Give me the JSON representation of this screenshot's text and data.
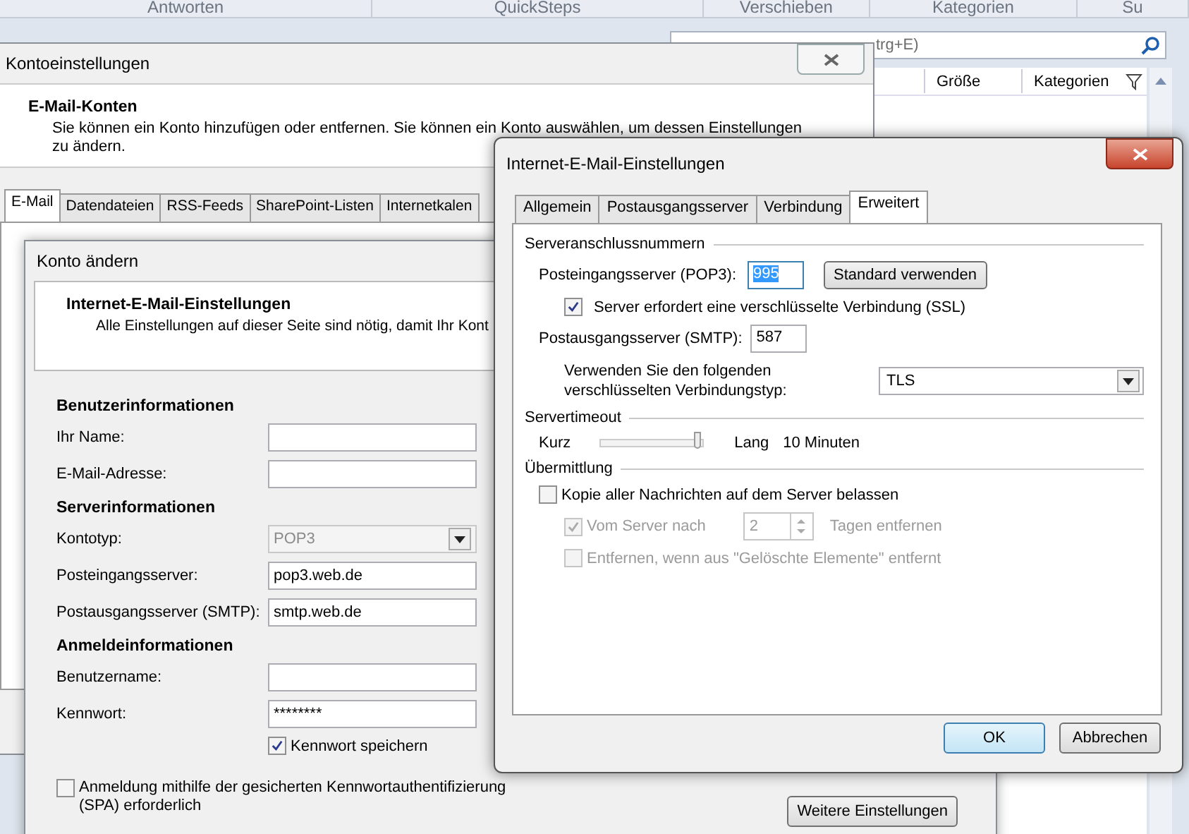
{
  "ribbon": {
    "groups": [
      "Antworten",
      "QuickSteps",
      "Verschieben",
      "Kategorien",
      "Su"
    ]
  },
  "mail_list": {
    "search": {
      "placeholder": "trg+E)"
    },
    "columns": [
      "Größe",
      "Kategorien"
    ]
  },
  "account_settings": {
    "title": "Kontoeinstellungen",
    "heading": "E-Mail-Konten",
    "description": "Sie können ein Konto hinzufügen oder entfernen. Sie können ein Konto auswählen, um dessen Einstellungen zu ändern.",
    "tabs": [
      {
        "label": "E-Mail",
        "selected": true
      },
      {
        "label": "Datendateien",
        "selected": false
      },
      {
        "label": "RSS-Feeds",
        "selected": false
      },
      {
        "label": "SharePoint-Listen",
        "selected": false
      },
      {
        "label": "Internetkalen",
        "selected": false
      }
    ]
  },
  "change_account": {
    "title": "Konto ändern",
    "heading": "Internet-E-Mail-Einstellungen",
    "description": "Alle Einstellungen auf dieser Seite sind nötig, damit Ihr Kont",
    "sections": [
      {
        "title": "Benutzerinformationen",
        "fields": [
          {
            "label": "Ihr Name:",
            "kind": "text",
            "disabled": false
          },
          {
            "label": "E-Mail-Adresse:",
            "kind": "text",
            "disabled": false
          }
        ]
      },
      {
        "title": "Serverinformationen",
        "fields": [
          {
            "label": "Kontotyp:",
            "kind": "select",
            "value": "POP3",
            "disabled": true
          },
          {
            "label": "Posteingangsserver:",
            "kind": "text",
            "value": "pop3.web.de",
            "disabled": false
          },
          {
            "label": "Postausgangsserver (SMTP):",
            "kind": "text",
            "value": "smtp.web.de",
            "disabled": false
          }
        ]
      },
      {
        "title": "Anmeldeinformationen",
        "fields": [
          {
            "label": "Benutzername:",
            "kind": "text",
            "disabled": false
          },
          {
            "label": "Kennwort:",
            "kind": "text",
            "value": "********",
            "disabled": false
          }
        ]
      }
    ],
    "remember_password": {
      "label": "Kennwort speichern",
      "checked": true
    },
    "spa": {
      "label": "Anmeldung mithilfe der gesicherten Kennwortauthentifizierung (SPA) erforderlich",
      "checked": false
    },
    "more_button": "Weitere Einstellungen"
  },
  "internet_settings": {
    "title": "Internet-E-Mail-Einstellungen",
    "tabs": [
      {
        "label": "Allgemein",
        "selected": false
      },
      {
        "label": "Postausgangsserver",
        "selected": false
      },
      {
        "label": "Verbindung",
        "selected": false
      },
      {
        "label": "Erweitert",
        "selected": true
      }
    ],
    "ports": {
      "title": "Serveranschlussnummern",
      "incoming_label": "Posteingangsserver (POP3):",
      "incoming_value": "995",
      "incoming_highlighted": true,
      "default_button": "Standard verwenden",
      "ssl": {
        "label": "Server erfordert eine verschlüsselte Verbindung (SSL)",
        "checked": true
      },
      "outgoing_label": "Postausgangsserver (SMTP):",
      "outgoing_value": "587",
      "encryption_label": "Verwenden Sie den folgenden verschlüsselten Verbindungstyp:",
      "encryption_value": "TLS"
    },
    "timeout": {
      "title": "Servertimeout",
      "min_label": "Kurz",
      "max_label": "Lang",
      "level": 0.97,
      "reading": "10 Minuten"
    },
    "delivery": {
      "title": "Übermittlung",
      "keep_copy": {
        "label": "Kopie aller Nachrichten auf dem Server belassen",
        "checked": false,
        "disabled": false
      },
      "remove_after": {
        "label": "Vom Server nach",
        "checked": true,
        "disabled": true,
        "days": "2",
        "suffix": "Tagen entfernen"
      },
      "remove_deleted": {
        "label": "Entfernen, wenn aus \"Gelöschte Elemente\" entfernt",
        "checked": false,
        "disabled": true
      }
    },
    "buttons": [
      {
        "label": "OK",
        "default": true
      },
      {
        "label": "Abbrechen",
        "default": false
      }
    ]
  }
}
